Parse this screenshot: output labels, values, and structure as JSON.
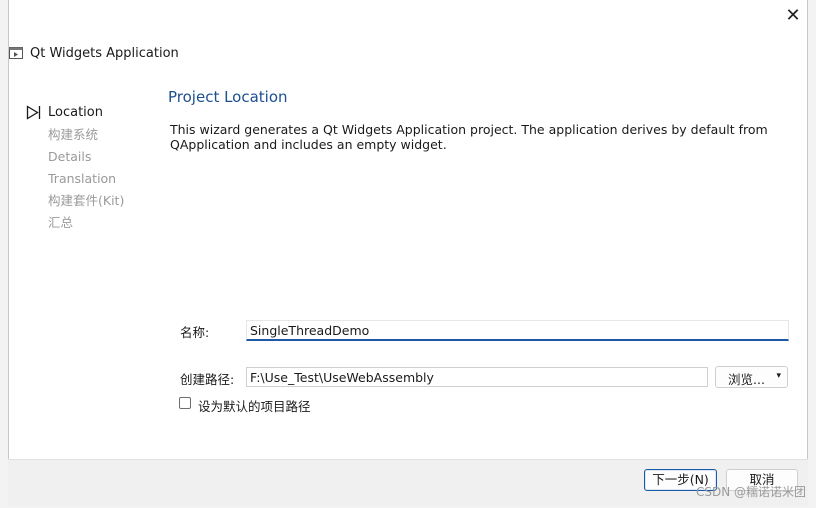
{
  "window": {
    "title": "Qt Widgets Application",
    "close_glyph": "✕"
  },
  "sidebar": {
    "items": [
      {
        "label": "Location",
        "active": true
      },
      {
        "label": "构建系统",
        "active": false
      },
      {
        "label": "Details",
        "active": false
      },
      {
        "label": "Translation",
        "active": false
      },
      {
        "label": "构建套件(Kit)",
        "active": false
      },
      {
        "label": "汇总",
        "active": false
      }
    ],
    "active_icon": "triangle-pointer-icon"
  },
  "page": {
    "title": "Project Location",
    "description": "This wizard generates a Qt Widgets Application project. The application derives by default from QApplication and includes an empty widget."
  },
  "form": {
    "name_label": "名称:",
    "name_value": "SingleThreadDemo",
    "path_label": "创建路径:",
    "path_value": "F:\\Use_Test\\UseWebAssembly",
    "browse_label": "浏览...",
    "browse_caret": "▾",
    "default_path_checkbox_label": "设为默认的项目路径",
    "default_path_checked": false
  },
  "footer": {
    "next_label": "下一步(N)",
    "cancel_label": "取消"
  },
  "watermark": "CSDN @糯诺诺米团",
  "colors": {
    "accent": "#1f5aa8",
    "title_blue": "#1d4f91",
    "inactive_text": "#9a9a9a"
  }
}
